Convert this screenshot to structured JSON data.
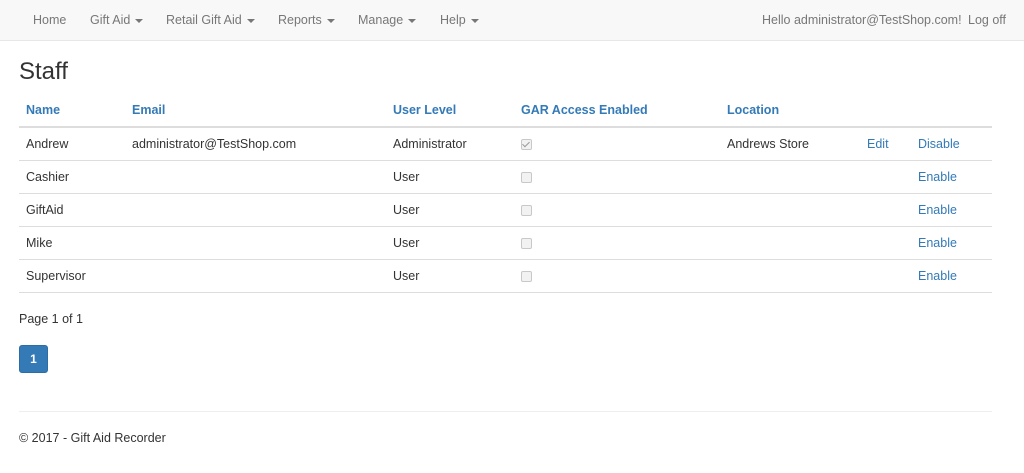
{
  "nav": {
    "left": [
      {
        "label": "Home",
        "dropdown": false
      },
      {
        "label": "Gift Aid",
        "dropdown": true
      },
      {
        "label": "Retail Gift Aid",
        "dropdown": true
      },
      {
        "label": "Reports",
        "dropdown": true
      },
      {
        "label": "Manage",
        "dropdown": true
      },
      {
        "label": "Help",
        "dropdown": true
      }
    ],
    "greeting": "Hello administrator@TestShop.com!",
    "logoff": "Log off"
  },
  "page": {
    "title": "Staff"
  },
  "table": {
    "headers": {
      "name": "Name",
      "email": "Email",
      "user_level": "User Level",
      "gar_access": "GAR Access Enabled",
      "location": "Location"
    },
    "rows": [
      {
        "name": "Andrew",
        "email": "administrator@TestShop.com",
        "user_level": "Administrator",
        "gar_access": true,
        "location": "Andrews Store",
        "edit": "Edit",
        "action": "Disable"
      },
      {
        "name": "Cashier",
        "email": "",
        "user_level": "User",
        "gar_access": false,
        "location": "",
        "edit": "",
        "action": "Enable"
      },
      {
        "name": "GiftAid",
        "email": "",
        "user_level": "User",
        "gar_access": false,
        "location": "",
        "edit": "",
        "action": "Enable"
      },
      {
        "name": "Mike",
        "email": "",
        "user_level": "User",
        "gar_access": false,
        "location": "",
        "edit": "",
        "action": "Enable"
      },
      {
        "name": "Supervisor",
        "email": "",
        "user_level": "User",
        "gar_access": false,
        "location": "",
        "edit": "",
        "action": "Enable"
      }
    ]
  },
  "pagination": {
    "info": "Page 1 of 1",
    "current": "1"
  },
  "footer": {
    "text": "© 2017 - Gift Aid Recorder"
  },
  "colors": {
    "link": "#337ab7",
    "navbar_bg": "#f8f8f8",
    "active_page": "#337ab7"
  }
}
